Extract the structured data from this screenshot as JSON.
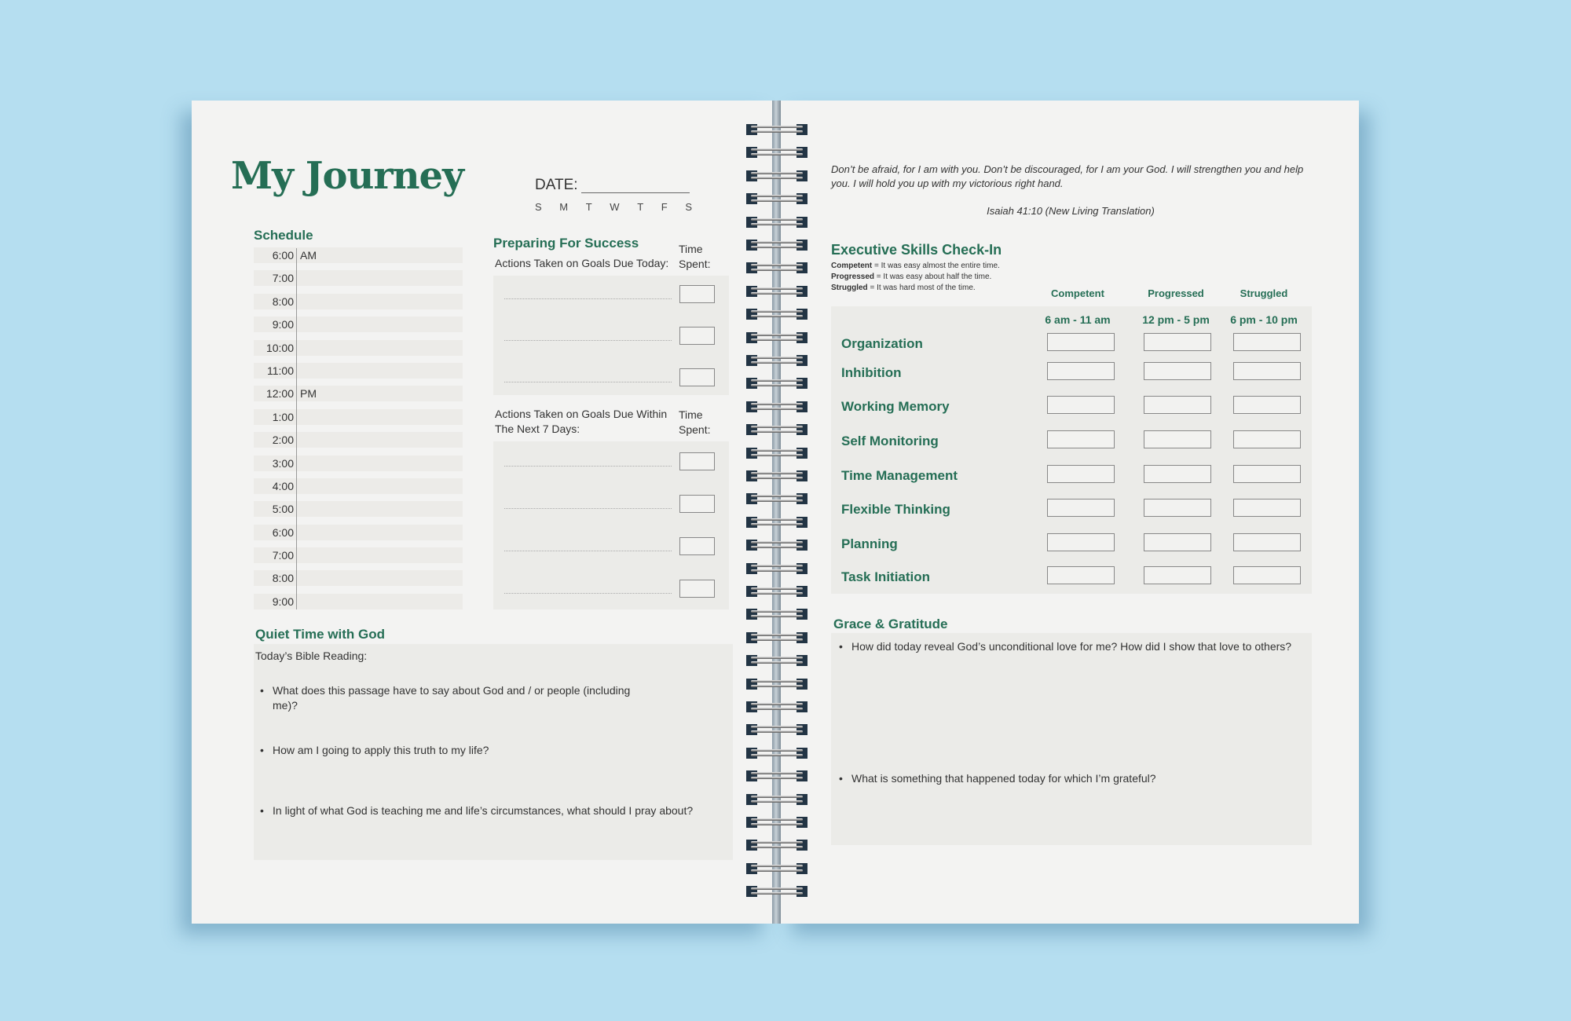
{
  "left_page": {
    "title": "My Journey",
    "date_label": "DATE:",
    "weekdays": [
      "S",
      "M",
      "T",
      "W",
      "T",
      "F",
      "S"
    ],
    "schedule": {
      "heading": "Schedule",
      "rows": [
        {
          "time": "6:00",
          "period": "AM"
        },
        {
          "time": "7:00",
          "period": ""
        },
        {
          "time": "8:00",
          "period": ""
        },
        {
          "time": "9:00",
          "period": ""
        },
        {
          "time": "10:00",
          "period": ""
        },
        {
          "time": "11:00",
          "period": ""
        },
        {
          "time": "12:00",
          "period": "PM"
        },
        {
          "time": "1:00",
          "period": ""
        },
        {
          "time": "2:00",
          "period": ""
        },
        {
          "time": "3:00",
          "period": ""
        },
        {
          "time": "4:00",
          "period": ""
        },
        {
          "time": "5:00",
          "period": ""
        },
        {
          "time": "6:00",
          "period": ""
        },
        {
          "time": "7:00",
          "period": ""
        },
        {
          "time": "8:00",
          "period": ""
        },
        {
          "time": "9:00",
          "period": ""
        }
      ]
    },
    "preparing": {
      "heading": "Preparing For Success",
      "today_label": "Actions Taken on Goals Due Today:",
      "week_label": "Actions Taken on Goals Due Within The Next 7 Days:",
      "time_spent_label": "Time Spent:",
      "today_lines": 3,
      "week_lines": 4
    },
    "quiet_time": {
      "heading": "Quiet Time with God",
      "reading_label": "Today’s Bible Reading:",
      "questions": [
        "What does this passage have to say about God and / or people (including me)?",
        "How am I going to apply this truth to my life?",
        "In light of what God is teaching me and life’s circumstances, what should I pray about?"
      ]
    }
  },
  "right_page": {
    "verse": "Don’t be afraid, for I am with you. Don’t be discouraged, for I am your God. I will strengthen you and help you. I will hold you up with my victorious right hand.",
    "verse_ref": "Isaiah 41:10 (New Living Translation)",
    "exec_skills": {
      "heading": "Executive Skills Check-In",
      "legend": [
        {
          "term": "Competent",
          "desc": " = It was easy almost the entire time."
        },
        {
          "term": "Progressed",
          "desc": " = It was easy about half the time."
        },
        {
          "term": "Struggled",
          "desc": " = It was hard most of the time."
        }
      ],
      "ratings": [
        "Competent",
        "Progressed",
        "Struggled"
      ],
      "time_slots": [
        "6 am - 11 am",
        "12 pm - 5 pm",
        "6 pm - 10 pm"
      ],
      "skills": [
        "Organization",
        "Inhibition",
        "Working Memory",
        "Self Monitoring",
        "Time Management",
        "Flexible Thinking",
        "Planning",
        "Task Initiation"
      ]
    },
    "gratitude": {
      "heading": "Grace & Gratitude",
      "questions": [
        "How did today reveal God’s unconditional love for me?  How did I show that love to others?",
        "What is something that happened today for which I’m grateful?"
      ]
    }
  },
  "colors": {
    "accent": "#256e55",
    "background": "#b5def0",
    "page": "#f3f3f2",
    "panel": "#ebebe8"
  }
}
